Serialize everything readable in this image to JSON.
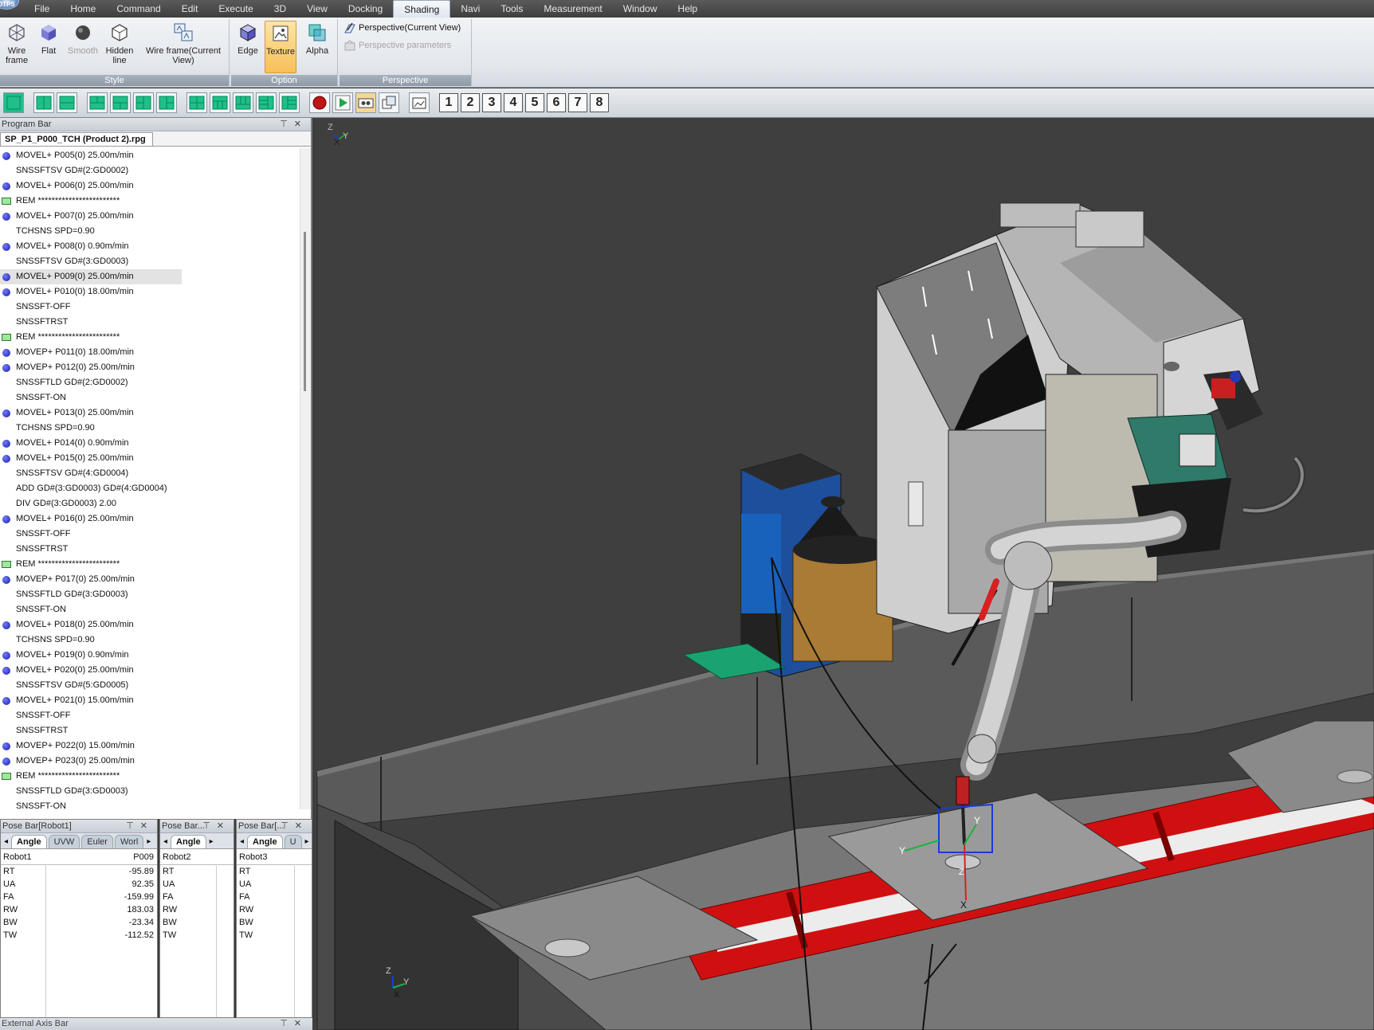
{
  "menu": {
    "logo_text": "DTPS",
    "items": [
      "File",
      "Home",
      "Command",
      "Edit",
      "Execute",
      "3D",
      "View",
      "Docking",
      "Shading",
      "Navi",
      "Tools",
      "Measurement",
      "Window",
      "Help"
    ],
    "active": "Shading"
  },
  "ribbon": {
    "style_group": {
      "label": "Style",
      "wire_frame": "Wire frame",
      "flat": "Flat",
      "smooth": "Smooth",
      "hidden_line": "Hidden line",
      "wire_frame_current": "Wire frame(Current View)"
    },
    "option_group": {
      "label": "Option",
      "edge": "Edge",
      "texture": "Texture",
      "alpha": "Alpha"
    },
    "perspective_group": {
      "label": "Perspective",
      "perspective_current": "Perspective(Current View)",
      "perspective_parameters": "Perspective parameters"
    }
  },
  "toolbar": {
    "numbers": [
      "1",
      "2",
      "3",
      "4",
      "5",
      "6",
      "7",
      "8"
    ]
  },
  "program_bar": {
    "title": "Program Bar",
    "file_tab": "SP_P1_P000_TCH (Product 2).rpg",
    "lines": [
      {
        "text": "MOVEL+ P005(0) 25.00m/min",
        "icon": "dot"
      },
      {
        "text": "SNSSFTSV GD#(2:GD0002)",
        "icon": "none"
      },
      {
        "text": "MOVEL+ P006(0) 25.00m/min",
        "icon": "dot"
      },
      {
        "text": "REM ************************",
        "icon": "rem"
      },
      {
        "text": "MOVEL+ P007(0) 25.00m/min",
        "icon": "dot"
      },
      {
        "text": "TCHSNS SPD=0.90",
        "icon": "none"
      },
      {
        "text": "MOVEL+ P008(0) 0.90m/min",
        "icon": "dot"
      },
      {
        "text": "SNSSFTSV GD#(3:GD0003)",
        "icon": "none"
      },
      {
        "text": "MOVEL+ P009(0) 25.00m/min",
        "icon": "dot",
        "selected": true
      },
      {
        "text": "MOVEL+ P010(0) 18.00m/min",
        "icon": "dot"
      },
      {
        "text": "SNSSFT-OFF",
        "icon": "none"
      },
      {
        "text": "SNSSFTRST",
        "icon": "none"
      },
      {
        "text": "REM ************************",
        "icon": "rem"
      },
      {
        "text": "MOVEP+ P011(0) 18.00m/min",
        "icon": "dot"
      },
      {
        "text": "MOVEP+ P012(0) 25.00m/min",
        "icon": "dot"
      },
      {
        "text": "SNSSFTLD GD#(2:GD0002)",
        "icon": "none"
      },
      {
        "text": "SNSSFT-ON",
        "icon": "none"
      },
      {
        "text": "MOVEL+ P013(0) 25.00m/min",
        "icon": "dot"
      },
      {
        "text": "TCHSNS SPD=0.90",
        "icon": "none"
      },
      {
        "text": "MOVEL+ P014(0) 0.90m/min",
        "icon": "dot"
      },
      {
        "text": "MOVEL+ P015(0) 25.00m/min",
        "icon": "dot"
      },
      {
        "text": "SNSSFTSV GD#(4:GD0004)",
        "icon": "none"
      },
      {
        "text": "ADD GD#(3:GD0003) GD#(4:GD0004)",
        "icon": "none"
      },
      {
        "text": "DIV GD#(3:GD0003) 2.00",
        "icon": "none"
      },
      {
        "text": "MOVEL+ P016(0) 25.00m/min",
        "icon": "dot"
      },
      {
        "text": "SNSSFT-OFF",
        "icon": "none"
      },
      {
        "text": "SNSSFTRST",
        "icon": "none"
      },
      {
        "text": "REM ************************",
        "icon": "rem"
      },
      {
        "text": "MOVEP+ P017(0) 25.00m/min",
        "icon": "dot"
      },
      {
        "text": "SNSSFTLD GD#(3:GD0003)",
        "icon": "none"
      },
      {
        "text": "SNSSFT-ON",
        "icon": "none"
      },
      {
        "text": "MOVEL+ P018(0) 25.00m/min",
        "icon": "dot"
      },
      {
        "text": "TCHSNS SPD=0.90",
        "icon": "none"
      },
      {
        "text": "MOVEL+ P019(0) 0.90m/min",
        "icon": "dot"
      },
      {
        "text": "MOVEL+ P020(0) 25.00m/min",
        "icon": "dot"
      },
      {
        "text": "SNSSFTSV GD#(5:GD0005)",
        "icon": "none"
      },
      {
        "text": "MOVEL+ P021(0) 15.00m/min",
        "icon": "dot"
      },
      {
        "text": "SNSSFT-OFF",
        "icon": "none"
      },
      {
        "text": "SNSSFTRST",
        "icon": "none"
      },
      {
        "text": "MOVEP+ P022(0) 15.00m/min",
        "icon": "dot"
      },
      {
        "text": "MOVEP+ P023(0) 25.00m/min",
        "icon": "dot"
      },
      {
        "text": "REM ************************",
        "icon": "rem"
      },
      {
        "text": "SNSSFTLD GD#(3:GD0003)",
        "icon": "none"
      },
      {
        "text": "SNSSFT-ON",
        "icon": "none"
      }
    ]
  },
  "pose_bars": [
    {
      "title": "Pose Bar[Robot1]",
      "tabs": [
        "Angle",
        "UVW",
        "Euler",
        "Worl"
      ],
      "robot": "Robot1",
      "point": "P009",
      "rows": [
        {
          "k": "RT",
          "v": "-95.89"
        },
        {
          "k": "UA",
          "v": "92.35"
        },
        {
          "k": "FA",
          "v": "-159.99"
        },
        {
          "k": "RW",
          "v": "183.03"
        },
        {
          "k": "BW",
          "v": "-23.34"
        },
        {
          "k": "TW",
          "v": "-112.52"
        }
      ]
    },
    {
      "title": "Pose Bar...",
      "tabs": [
        "Angle"
      ],
      "robot": "Robot2",
      "point": "",
      "rows": [
        {
          "k": "RT",
          "v": ""
        },
        {
          "k": "UA",
          "v": ""
        },
        {
          "k": "FA",
          "v": ""
        },
        {
          "k": "RW",
          "v": ""
        },
        {
          "k": "BW",
          "v": ""
        },
        {
          "k": "TW",
          "v": ""
        }
      ]
    },
    {
      "title": "Pose Bar[...",
      "tabs": [
        "Angle",
        "U"
      ],
      "robot": "Robot3",
      "point": "",
      "rows": [
        {
          "k": "RT",
          "v": ""
        },
        {
          "k": "UA",
          "v": ""
        },
        {
          "k": "FA",
          "v": ""
        },
        {
          "k": "RW",
          "v": ""
        },
        {
          "k": "BW",
          "v": ""
        },
        {
          "k": "TW",
          "v": ""
        }
      ]
    }
  ],
  "external_axis_bar": {
    "title": "External Axis Bar"
  },
  "viewport": {
    "axis_labels": {
      "x": "X",
      "y": "Y",
      "z": "Z"
    }
  },
  "colors": {
    "ribbon_active": "#f7bf5a",
    "rail_red": "#d01010",
    "floor": "#3f3f3f",
    "robot_body": "#b9b9b9"
  }
}
